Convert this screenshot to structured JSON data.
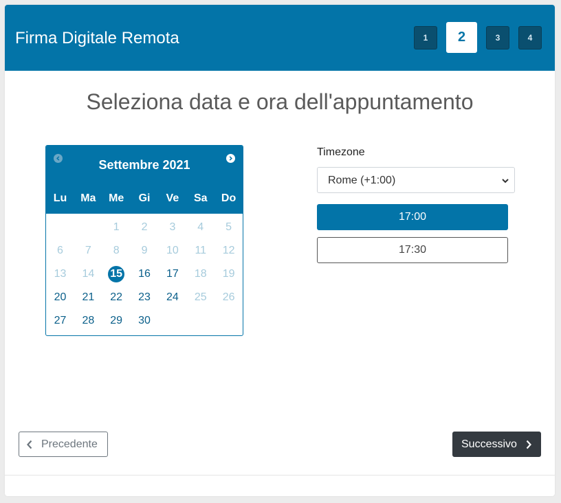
{
  "header": {
    "title": "Firma Digitale Remota",
    "steps": [
      "1",
      "2",
      "3",
      "4"
    ],
    "active_step": "2"
  },
  "main": {
    "title": "Seleziona data e ora dell'appuntamento"
  },
  "calendar": {
    "month_label": "Settembre 2021",
    "weekdays": [
      "Lu",
      "Ma",
      "Me",
      "Gi",
      "Ve",
      "Sa",
      "Do"
    ],
    "rows": [
      [
        "",
        "",
        "1",
        "2",
        "3",
        "4",
        "5"
      ],
      [
        "6",
        "7",
        "8",
        "9",
        "10",
        "11",
        "12"
      ],
      [
        "13",
        "14",
        "15",
        "16",
        "17",
        "18",
        "19"
      ],
      [
        "20",
        "21",
        "22",
        "23",
        "24",
        "25",
        "26"
      ],
      [
        "27",
        "28",
        "29",
        "30",
        "",
        "",
        ""
      ]
    ],
    "selected_day": "15",
    "available_days": [
      "15",
      "16",
      "17",
      "20",
      "21",
      "22",
      "23",
      "24",
      "27",
      "28",
      "29",
      "30"
    ],
    "icons": {
      "prev": "chevron-left-circle-icon",
      "next": "chevron-right-circle-icon"
    }
  },
  "timezone": {
    "label": "Timezone",
    "selected": "Rome (+1:00)"
  },
  "slots": {
    "items": [
      "17:00",
      "17:30"
    ],
    "active": "17:00"
  },
  "footer": {
    "prev_label": "Precedente",
    "next_label": "Successivo"
  },
  "colors": {
    "primary": "#0374a8",
    "step_inactive": "#0a4f6f",
    "dark_button": "#343a40",
    "disabled_day": "#a6cbdc"
  }
}
